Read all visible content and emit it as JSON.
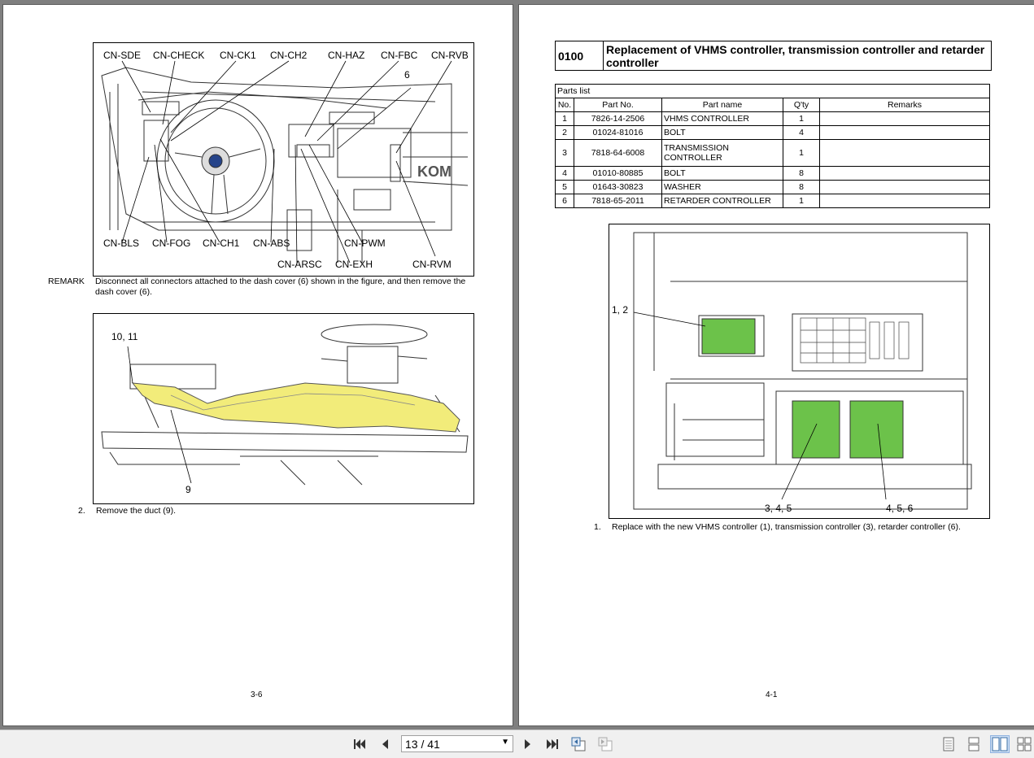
{
  "left_page": {
    "figure1_callouts": {
      "cn_sde": "CN-SDE",
      "cn_check": "CN-CHECK",
      "cn_ck1": "CN-CK1",
      "cn_ch2": "CN-CH2",
      "cn_haz": "CN-HAZ",
      "cn_fbc": "CN-FBC",
      "cn_rvb": "CN-RVB",
      "six": "6",
      "cn_bls": "CN-BLS",
      "cn_fog": "CN-FOG",
      "cn_ch1": "CN-CH1",
      "cn_abs": "CN-ABS",
      "cn_pwm": "CN-PWM",
      "cn_arsc": "CN-ARSC",
      "cn_exh": "CN-EXH",
      "cn_rvm": "CN-RVM",
      "brand": "KOM"
    },
    "remark_label": "REMARK",
    "remark_text": "Disconnect all connectors attached to the dash cover (6) shown in the figure, and then remove the dash cover (6).",
    "figure2_callouts": {
      "ten_eleven": "10, 11",
      "nine": "9"
    },
    "step_number": "2.",
    "step_text": "Remove the duct (9).",
    "page_number": "3-6"
  },
  "right_page": {
    "section_code": "0100",
    "section_title": "Replacement of VHMS controller, transmission controller and retarder controller",
    "parts_caption": "Parts list",
    "columns": [
      "No.",
      "Part No.",
      "Part name",
      "Q'ty",
      "Remarks"
    ],
    "rows": [
      {
        "no": "1",
        "part_no": "7826-14-2506",
        "name": "VHMS CONTROLLER",
        "qty": "1",
        "remarks": ""
      },
      {
        "no": "2",
        "part_no": "01024-81016",
        "name": "BOLT",
        "qty": "4",
        "remarks": ""
      },
      {
        "no": "3",
        "part_no": "7818-64-6008",
        "name": "TRANSMISSION CONTROLLER",
        "qty": "1",
        "remarks": ""
      },
      {
        "no": "4",
        "part_no": "01010-80885",
        "name": "BOLT",
        "qty": "8",
        "remarks": ""
      },
      {
        "no": "5",
        "part_no": "01643-30823",
        "name": "WASHER",
        "qty": "8",
        "remarks": ""
      },
      {
        "no": "6",
        "part_no": "7818-65-2011",
        "name": "RETARDER CONTROLLER",
        "qty": "1",
        "remarks": ""
      }
    ],
    "figure_callouts": {
      "one_two": "1, 2",
      "three_four_five": "3, 4, 5",
      "four_five_six": "4, 5, 6"
    },
    "step_number": "1.",
    "step_text": "Replace with the new VHMS controller (1), transmission controller (3), retarder controller (6).",
    "page_number": "4-1"
  },
  "toolbar": {
    "page_indicator": "13 / 41",
    "icons": [
      "first-page-icon",
      "prev-page-icon",
      "next-page-icon",
      "last-page-icon",
      "go-back-icon",
      "go-forward-icon",
      "single-page-view-icon",
      "continuous-view-icon",
      "two-page-view-icon",
      "two-page-continuous-view-icon"
    ]
  },
  "colors": {
    "highlight_yellow": "#f2ec7a",
    "controller_green": "#6cc24a",
    "background": "#7f7f7f"
  }
}
